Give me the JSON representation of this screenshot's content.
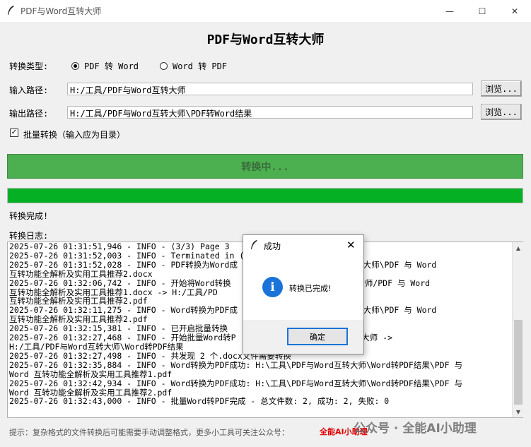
{
  "window": {
    "title": "PDF与Word互转大师",
    "minimize_glyph": "—",
    "maximize_glyph": "☐",
    "close_glyph": "✕",
    "icon": "feather-icon"
  },
  "heading": "PDF与Word互转大师",
  "convert_type": {
    "label": "转换类型:",
    "options": [
      {
        "label": "PDF 转 Word",
        "selected": true
      },
      {
        "label": "Word 转 PDF",
        "selected": false
      }
    ]
  },
  "input_path": {
    "label": "输入路径:",
    "value": "H:/工具/PDF与Word互转大师",
    "browse_label": "浏览..."
  },
  "output_path": {
    "label": "输出路径:",
    "value": "H:/工具/PDF与Word互转大师\\PDF转Word结果",
    "browse_label": "浏览..."
  },
  "batch": {
    "checked": true,
    "check_glyph": "✓",
    "label": "批量转换（输入应为目录）"
  },
  "convert_button_label": "转换中...",
  "progress_percent": 100,
  "status_text": "转换完成!",
  "log": {
    "label": "转换日志:",
    "text": "2025-07-26 01:31:51,946 - INFO - (3/3) Page 3\n2025-07-26 01:31:52,003 - INFO - Terminated in (\n2025-07-26 01:31:52,028 - INFO - PDF转换为Word成                        转大师\\PDF 与 Word\n互转功能全解析及实用工具推荐2.docx\n2025-07-26 01:32:06,742 - INFO - 开始将Word转换                        转大师/PDF 与 Word\n互转功能全解析及实用工具推荐1.docx -> H:/工具/PD                        ord\n互转功能全解析及实用工具推荐2.pdf\n2025-07-26 01:32:11,275 - INFO - Word转换为PDF成                        转大师\\PDF 与 Word\n互转功能全解析及实用工具推荐2.pdf\n2025-07-26 01:32:15,381 - INFO - 已开启批量转换\n2025-07-26 01:32:27,468 - INFO - 开始批量Word转P                        转大师 ->\nH:/工具/PDF与Word互转大师\\Word转PDF结果\n2025-07-26 01:32:27,498 - INFO - 共发现 2 个.docx文件需要转换\n2025-07-26 01:32:35,884 - INFO - Word转换为PDF成功: H:\\工具\\PDF与Word互转大师\\Word转PDF结果\\PDF 与\nWord 互转功能全解析及实用工具推荐1.pdf\n2025-07-26 01:32:42,934 - INFO - Word转换为PDF成功: H:\\工具\\PDF与Word互转大师\\Word转PDF结果\\PDF 与\nWord 互转功能全解析及实用工具推荐2.pdf\n2025-07-26 01:32:43,000 - INFO - 批量Word转PDF完成 - 总文件数: 2, 成功: 2, 失败: 0"
  },
  "footer": {
    "note": "提示：复杂格式的文件转换后可能需要手动调整格式，更多小工具可关注公众号：",
    "link": "全能AI小助理",
    "watermark": "公众号 · 全能AI小助理"
  },
  "dialog": {
    "title": "成功",
    "message": "转换已完成!",
    "ok_label": "确定",
    "info_glyph": "i",
    "close_glyph": "✕"
  },
  "colors": {
    "convert_button": "#4caf50",
    "progress_fill": "#06b025",
    "footer_link": "#e00000",
    "info_icon": "#1a73d9"
  }
}
